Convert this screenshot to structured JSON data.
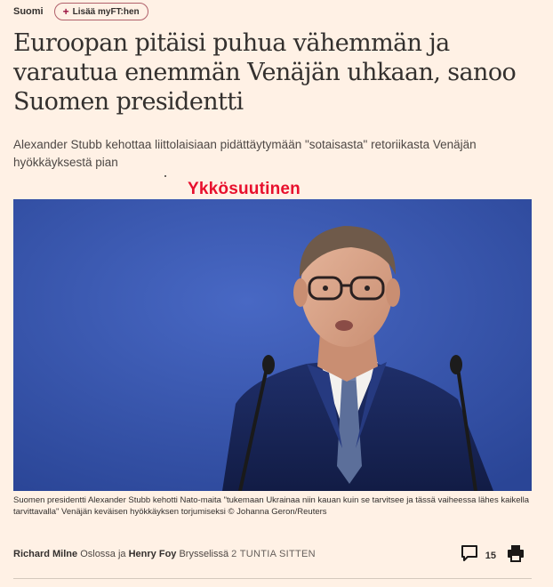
{
  "topbar": {
    "section": "Suomi",
    "myft_label": "Lisää myFT:hen"
  },
  "article": {
    "headline": "Euroopan pitäisi puhua vähemmän ja varautua enemmän Venäjän uhkaan, sanoo Suomen presidentti",
    "standfirst": "Alexander Stubb kehottaa liittolaisiaan pidättäytymään \"sotaisasta\" retoriikasta Venäjän hyökkäyksestä pian",
    "overlay_label": "Ykkösuutinen",
    "caption": "Suomen presidentti Alexander Stubb kehotti Nato-maita \"tukemaan Ukrainaa niin kauan kuin se tarvitsee ja tässä vaiheessa lähes kaikella tarvittavalla\" Venäjän keväisen hyökkäyksen torjumiseksi © Johanna Geron/Reuters"
  },
  "byline": {
    "author1": "Richard Milne",
    "location1": "Oslossa ja",
    "author2": "Henry Foy",
    "location2": "Brysselissä",
    "time": "2 TUNTIA SITTEN"
  },
  "actions": {
    "comment_count": "15",
    "comment_icon": "comment-icon",
    "print_icon": "print-icon"
  },
  "colors": {
    "background": "#fff1e5",
    "overlay_red": "#e8102d",
    "photo_backdrop": "#3452a6",
    "myft_accent": "#990f3d"
  }
}
